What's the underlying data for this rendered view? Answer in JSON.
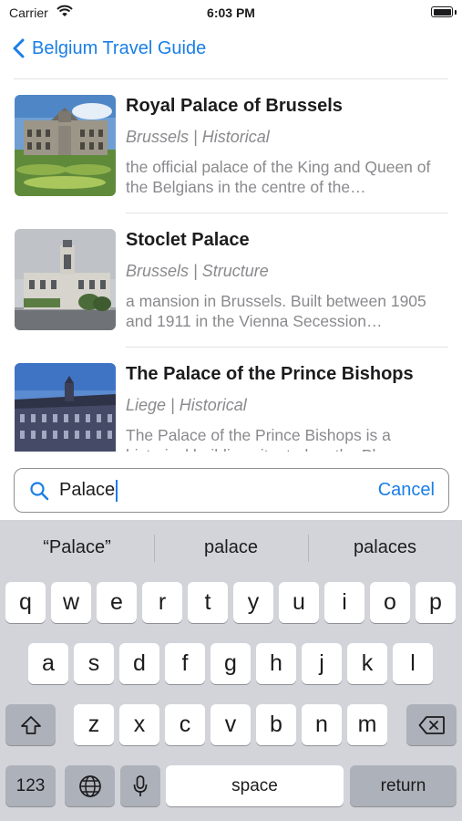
{
  "status_bar": {
    "carrier": "Carrier",
    "time": "6:03 PM"
  },
  "nav": {
    "back_label": "Belgium Travel Guide"
  },
  "results": [
    {
      "title": "Royal Palace of Brussels",
      "meta": "Brussels | Historical",
      "description": "the official palace of the King and Queen of the Belgians in the centre of the…"
    },
    {
      "title": "Stoclet Palace",
      "meta": "Brussels | Structure",
      "description": "a mansion in Brussels. Built between 1905 and 1911 in the Vienna Secession…"
    },
    {
      "title": "The Palace of the Prince Bishops",
      "meta": "Liege | Historical",
      "description": "The Palace of the Prince Bishops is a historical building situated on the Place…"
    }
  ],
  "search": {
    "query": "Palace",
    "cancel_label": "Cancel"
  },
  "keyboard": {
    "suggestions": [
      "“Palace”",
      "palace",
      "palaces"
    ],
    "row1": [
      "q",
      "w",
      "e",
      "r",
      "t",
      "y",
      "u",
      "i",
      "o",
      "p"
    ],
    "row2": [
      "a",
      "s",
      "d",
      "f",
      "g",
      "h",
      "j",
      "k",
      "l"
    ],
    "row3": [
      "z",
      "x",
      "c",
      "v",
      "b",
      "n",
      "m"
    ],
    "numbers_label": "123",
    "space_label": "space",
    "return_label": "return"
  },
  "colors": {
    "accent": "#1a7ee6",
    "keyboard_bg": "#d2d4da"
  }
}
